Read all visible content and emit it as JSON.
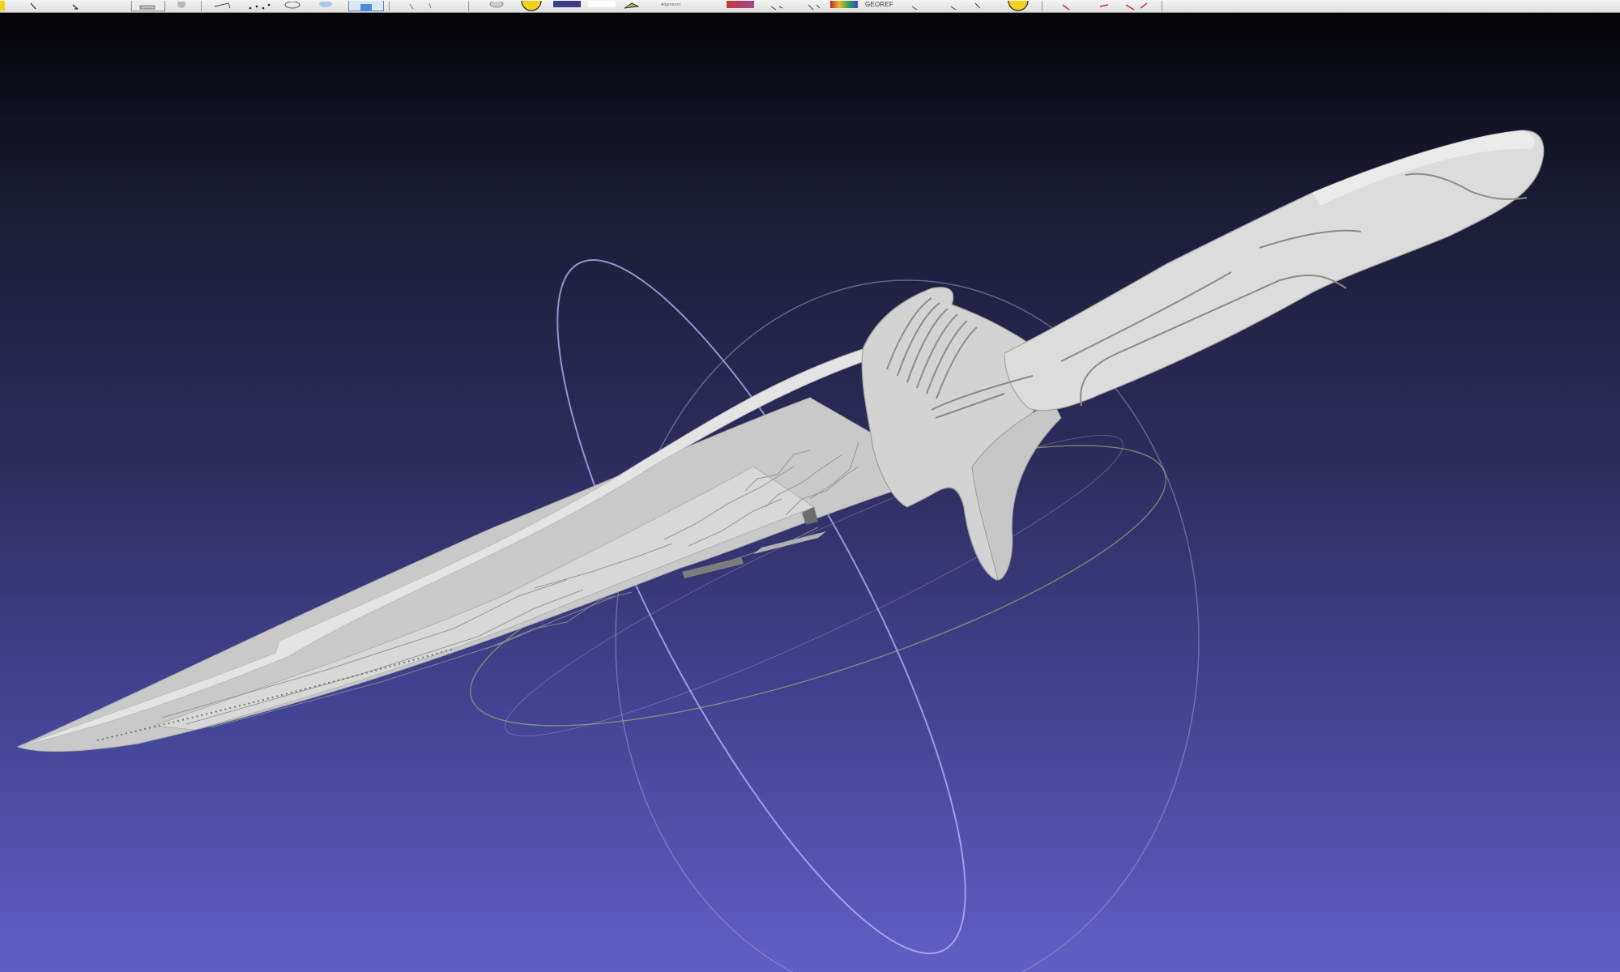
{
  "toolbar": {
    "labels": {
      "alignment": "Alignment",
      "georef": "GEOREF"
    },
    "colors": {
      "bar_bg": "#e6e6e6",
      "yellow_icon": "#f2d21a",
      "swatch_blue": "#3d3f8a",
      "swatch_white": "#ffffff",
      "swatch_red": "#c23a3a",
      "accent_blue": "#4a8ed8"
    },
    "icons": [
      "layer-icon",
      "sphere-icon",
      "box-select-icon",
      "points-icon",
      "wireframe-icon",
      "light-icon",
      "selected-tool-icon",
      "pick-icon",
      "sun-icon",
      "color-swatch-icon",
      "white-swatch-icon",
      "measure-icon",
      "gradient-icon",
      "tool-icons",
      "georef-icon",
      "trackball-icon",
      "red-tools-icon"
    ]
  },
  "viewport": {
    "background_top": "#050508",
    "background_bottom": "#5e60c6",
    "model": "knife-mesh",
    "trackball": "trackball-gizmo",
    "mesh_color": "#cfcfcf"
  }
}
